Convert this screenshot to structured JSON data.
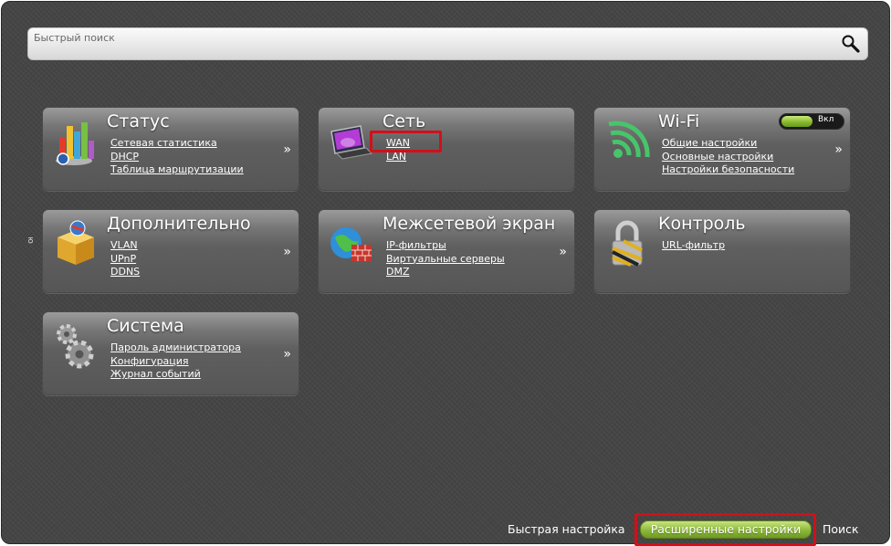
{
  "search": {
    "placeholder": "Быстрый поиск"
  },
  "side_char": "ю",
  "tiles": {
    "status": {
      "title": "Статус",
      "links": [
        "Сетевая статистика",
        "DHCP",
        "Таблица маршрутизации"
      ],
      "arrow": "»"
    },
    "network": {
      "title": "Сеть",
      "links": [
        "WAN",
        "LAN"
      ]
    },
    "wifi": {
      "title": "Wi-Fi",
      "toggle_label": "Вкл",
      "toggle_on": true,
      "links": [
        "Общие настройки",
        "Основные настройки",
        "Настройки безопасности"
      ],
      "arrow": "»"
    },
    "advanced": {
      "title": "Дополнительно",
      "links": [
        "VLAN",
        "UPnP",
        "DDNS"
      ],
      "arrow": "»"
    },
    "firewall": {
      "title": "Межсетевой экран",
      "links": [
        "IP-фильтры",
        "Виртуальные серверы",
        "DMZ"
      ],
      "arrow": "»"
    },
    "control": {
      "title": "Контроль",
      "links": [
        "URL-фильтр"
      ]
    },
    "system": {
      "title": "Система",
      "links": [
        "Пароль администратора",
        "Конфигурация",
        "Журнал событий"
      ],
      "arrow": "»"
    }
  },
  "bottom": {
    "quick_setup": "Быстрая настройка",
    "advanced_settings": "Расширенные настройки",
    "search": "Поиск"
  },
  "colors": {
    "highlight": "#d0101a",
    "accent_green": "#8cb83a",
    "background": "#454545"
  },
  "icons": {
    "status": "bar-chart-icon",
    "network": "computer-icon",
    "wifi": "wifi-icon",
    "advanced": "box-icon",
    "firewall": "globe-firewall-icon",
    "control": "padlock-icon",
    "system": "gears-icon",
    "search": "search-icon"
  }
}
